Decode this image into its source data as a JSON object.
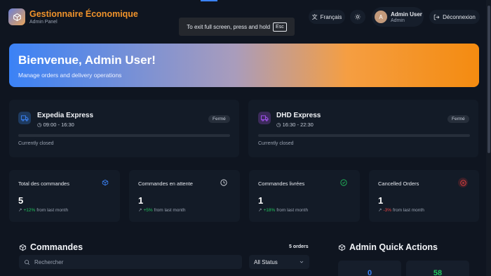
{
  "header": {
    "brand_title": "Gestionnaire Économique",
    "brand_sub": "Admin Panel",
    "language": "Français",
    "user_name": "Admin User",
    "user_role": "Admin",
    "avatar_initial": "A",
    "logout": "Déconnexion"
  },
  "fullscreen_toast": {
    "text": "To exit full screen, press and hold",
    "key": "Esc"
  },
  "banner": {
    "title": "Bienvenue, Admin User!",
    "subtitle": "Manage orders and delivery operations"
  },
  "services": [
    {
      "name": "Expedia Express",
      "hours": "09:00 - 16:30",
      "badge": "Fermé",
      "status": "Currently closed",
      "progress": 0,
      "accent": "#3b82f6"
    },
    {
      "name": "DHD Express",
      "hours": "16:30 - 22:30",
      "badge": "Fermé",
      "status": "Currently closed",
      "progress": 0,
      "accent": "#a855f7"
    }
  ],
  "stats": [
    {
      "label": "Total des commandes",
      "value": "5",
      "change": "+12%",
      "suffix": "from last month",
      "icon": "package-icon",
      "color": "#3b82f6"
    },
    {
      "label": "Commandes en attente",
      "value": "1",
      "change": "+5%",
      "suffix": "from last month",
      "icon": "clock-icon",
      "color": "#e6e9ef"
    },
    {
      "label": "Commandes livrées",
      "value": "1",
      "change": "+18%",
      "suffix": "from last month",
      "icon": "check-circle-icon",
      "color": "#22c55e"
    },
    {
      "label": "Cancelled Orders",
      "value": "1",
      "change": "-3%",
      "suffix": "from last month",
      "icon": "x-circle-icon",
      "color": "#ef4444"
    }
  ],
  "orders": {
    "title": "Commandes",
    "count": "5 orders",
    "search_placeholder": "Rechercher",
    "status_filter": "All Status"
  },
  "quick_actions": {
    "title": "Admin Quick Actions",
    "tiles": [
      {
        "value": "0",
        "color": "#3b82f6"
      },
      {
        "value": "58",
        "color": "#22c55e"
      }
    ]
  }
}
